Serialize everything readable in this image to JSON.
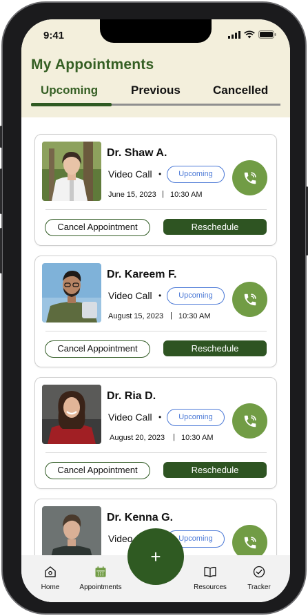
{
  "status_bar": {
    "time": "9:41"
  },
  "header": {
    "title": "My Appointments"
  },
  "tabs": [
    {
      "label": "Upcoming",
      "active": true
    },
    {
      "label": "Previous",
      "active": false
    },
    {
      "label": "Cancelled",
      "active": false
    }
  ],
  "appointments": [
    {
      "doctor": "Dr. Shaw A.",
      "type": "Video Call",
      "status": "Upcoming",
      "date": "June 15, 2023",
      "time": "10:30 AM",
      "cancel_label": "Cancel Appointment",
      "reschedule_label": "Reschedule"
    },
    {
      "doctor": "Dr. Kareem F.",
      "type": "Video Call",
      "status": "Upcoming",
      "date": "August 15, 2023",
      "time": "10:30 AM",
      "cancel_label": "Cancel Appointment",
      "reschedule_label": "Reschedule"
    },
    {
      "doctor": "Dr. Ria D.",
      "type": "Video Call",
      "status": "Upcoming",
      "date": "August 20, 2023",
      "time": "10:30 AM",
      "cancel_label": "Cancel Appointment",
      "reschedule_label": "Reschedule"
    },
    {
      "doctor": "Dr. Kenna G.",
      "type": "Video",
      "status": "Upcoming"
    }
  ],
  "bottom_nav": {
    "items": [
      {
        "label": "Home",
        "icon": "home-icon"
      },
      {
        "label": "Appointments",
        "icon": "calendar-icon"
      },
      {
        "label": "Resources",
        "icon": "book-icon"
      },
      {
        "label": "Tracker",
        "icon": "check-circle-icon"
      }
    ],
    "fab_symbol": "+"
  },
  "colors": {
    "brand_green": "#2f5a22",
    "accent_green": "#719c45",
    "header_bg": "#f3efdc",
    "badge_blue": "#4a78d6"
  }
}
